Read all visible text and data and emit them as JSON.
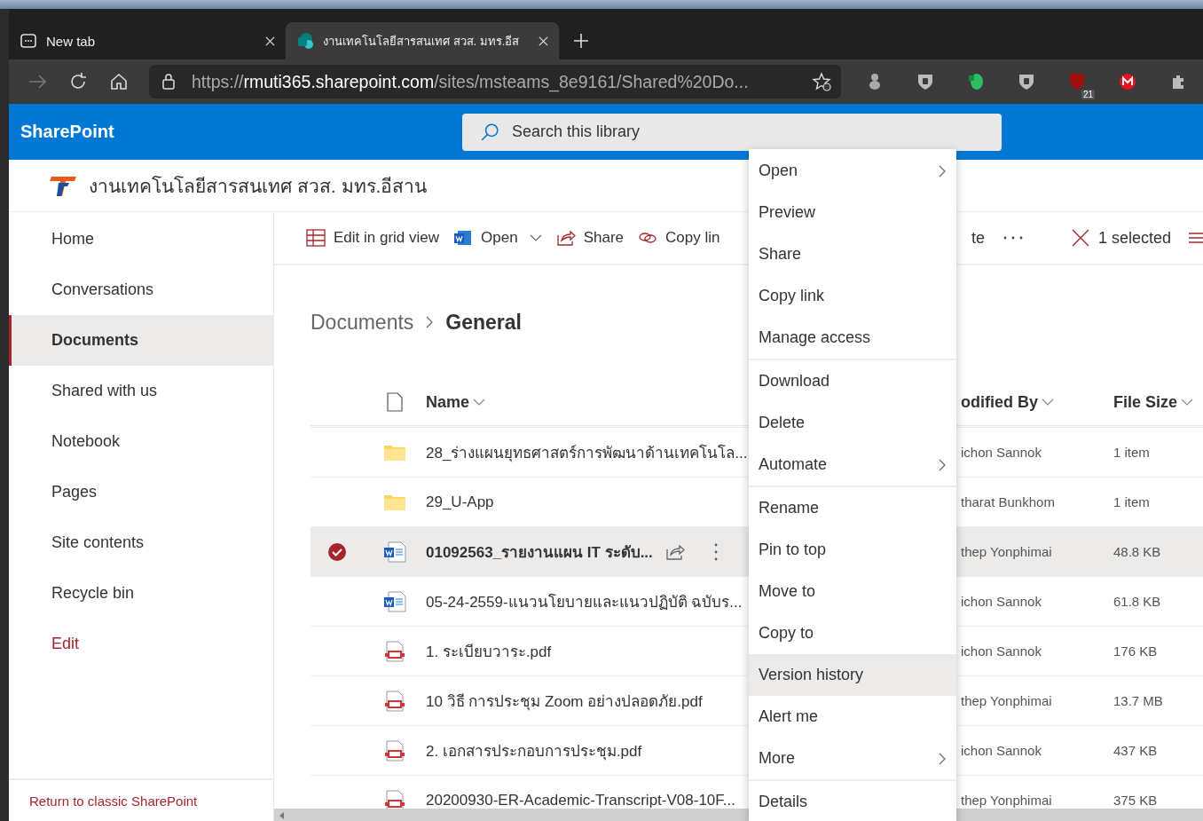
{
  "browser": {
    "tabs": [
      {
        "kind": "newtab",
        "title": "New tab",
        "selected": false
      },
      {
        "kind": "site",
        "title": "งานเทคโนโลยีสารสนเทศ สวส. มทร.อีส",
        "selected": true
      }
    ],
    "url": {
      "scheme": "https://",
      "host": "rmuti365.sharepoint.com",
      "path": "/sites/msteams_8e9161/Shared%20Do..."
    },
    "extension_badge": "21"
  },
  "app": {
    "name": "SharePoint",
    "search": {
      "placeholder": "Search this library"
    }
  },
  "site": {
    "title": "งานเทคโนโลยีสารสนเทศ สวส. มทร.อีสาน"
  },
  "sidebar": {
    "items": [
      {
        "label": "Home",
        "kind": "page",
        "selected": false
      },
      {
        "label": "Conversations",
        "kind": "page",
        "selected": false
      },
      {
        "label": "Documents",
        "kind": "page",
        "selected": true
      },
      {
        "label": "Shared with us",
        "kind": "page",
        "selected": false
      },
      {
        "label": "Notebook",
        "kind": "page",
        "selected": false
      },
      {
        "label": "Pages",
        "kind": "page",
        "selected": false
      },
      {
        "label": "Site contents",
        "kind": "page",
        "selected": false
      },
      {
        "label": "Recycle bin",
        "kind": "page",
        "selected": false
      },
      {
        "label": "Edit",
        "kind": "link",
        "selected": false
      }
    ],
    "footer_link": "Return to classic SharePoint"
  },
  "toolbar": {
    "items": [
      {
        "kind": "grid",
        "label": "Edit in grid view"
      },
      {
        "kind": "open",
        "label": "Open"
      },
      {
        "kind": "share",
        "label": "Share"
      },
      {
        "kind": "link",
        "label": "Copy lin"
      }
    ],
    "cut_item": "te",
    "selection": "1 selected"
  },
  "breadcrumb": [
    "Documents",
    "General"
  ],
  "table": {
    "columns": {
      "name": "Name",
      "modified_by": "odified By",
      "file_size": "File Size"
    },
    "rows": [
      {
        "kind": "folder",
        "name": "28_ร่างแผนยุทธศาสตร์การพัฒนาด้านเทคโนโล...",
        "modified_by": "ichon Sannok",
        "file_size": "1 item",
        "selected": false
      },
      {
        "kind": "folder",
        "name": "29_U-App",
        "modified_by": "tharat Bunkhom",
        "file_size": "1 item",
        "selected": false
      },
      {
        "kind": "word",
        "name": "01092563_รายงานแผน IT ระดับ...",
        "modified_by": "thep Yonphimai",
        "file_size": "48.8 KB",
        "selected": true
      },
      {
        "kind": "word",
        "name": "05-24-2559-แนวนโยบายและแนวปฏิบัติ ฉบับร...",
        "modified_by": "ichon Sannok",
        "file_size": "61.8 KB",
        "selected": false
      },
      {
        "kind": "pdf",
        "name": "1. ระเบียบวาระ.pdf",
        "modified_by": "ichon Sannok",
        "file_size": "176 KB",
        "selected": false
      },
      {
        "kind": "pdf",
        "name": "10 วิธี การประชุม Zoom อย่างปลอดภัย.pdf",
        "modified_by": "thep Yonphimai",
        "file_size": "13.7 MB",
        "selected": false
      },
      {
        "kind": "pdf",
        "name": "2. เอกสารประกอบการประชุม.pdf",
        "modified_by": "ichon Sannok",
        "file_size": "437 KB",
        "selected": false
      },
      {
        "kind": "pdf",
        "name": "20200930-ER-Academic-Transcript-V08-10F...",
        "modified_by": "thep Yonphimai",
        "file_size": "375 KB",
        "selected": false
      }
    ]
  },
  "context_menu": {
    "groups": [
      [
        {
          "label": "Open",
          "submenu": true,
          "highlighted": false
        },
        {
          "label": "Preview",
          "submenu": false,
          "highlighted": false
        },
        {
          "label": "Share",
          "submenu": false,
          "highlighted": false
        },
        {
          "label": "Copy link",
          "submenu": false,
          "highlighted": false
        },
        {
          "label": "Manage access",
          "submenu": false,
          "highlighted": false
        }
      ],
      [
        {
          "label": "Download",
          "submenu": false,
          "highlighted": false
        },
        {
          "label": "Delete",
          "submenu": false,
          "highlighted": false
        },
        {
          "label": "Automate",
          "submenu": true,
          "highlighted": false
        }
      ],
      [
        {
          "label": "Rename",
          "submenu": false,
          "highlighted": false
        },
        {
          "label": "Pin to top",
          "submenu": false,
          "highlighted": false
        },
        {
          "label": "Move to",
          "submenu": false,
          "highlighted": false
        },
        {
          "label": "Copy to",
          "submenu": false,
          "highlighted": false
        },
        {
          "label": "Version history",
          "submenu": false,
          "highlighted": true
        },
        {
          "label": "Alert me",
          "submenu": false,
          "highlighted": false
        },
        {
          "label": "More",
          "submenu": true,
          "highlighted": false
        }
      ],
      [
        {
          "label": "Details",
          "submenu": false,
          "highlighted": false
        }
      ]
    ]
  }
}
